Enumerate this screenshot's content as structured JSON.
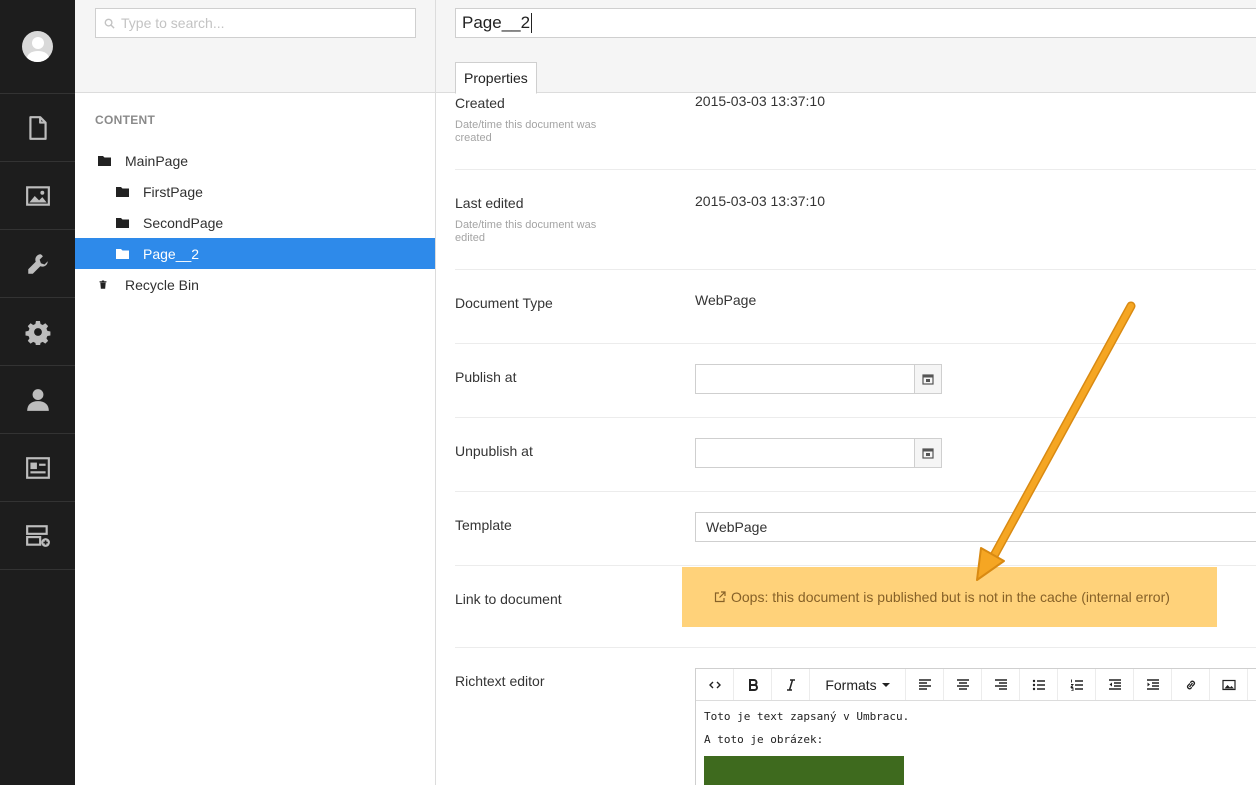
{
  "appbar": {
    "items": [
      {
        "name": "content-section",
        "icon": "document-icon"
      },
      {
        "name": "media-section",
        "icon": "image-icon"
      },
      {
        "name": "settings-section",
        "icon": "wrench-icon"
      },
      {
        "name": "developer-section",
        "icon": "gear-icon"
      },
      {
        "name": "users-section",
        "icon": "user-icon"
      },
      {
        "name": "members-section",
        "icon": "id-card-icon"
      },
      {
        "name": "forms-section",
        "icon": "add-layout-icon"
      }
    ]
  },
  "tree": {
    "search_placeholder": "Type to search...",
    "section_title": "CONTENT",
    "items": [
      {
        "label": "MainPage",
        "level": 0,
        "icon": "folder-icon"
      },
      {
        "label": "FirstPage",
        "level": 1,
        "icon": "folder-icon"
      },
      {
        "label": "SecondPage",
        "level": 1,
        "icon": "folder-icon"
      },
      {
        "label": "Page__2",
        "level": 1,
        "icon": "folder-icon",
        "selected": true
      },
      {
        "label": "Recycle Bin",
        "level": 0,
        "icon": "trash-icon"
      }
    ]
  },
  "editor": {
    "document_name": "Page__2",
    "tab_label": "Properties",
    "props": {
      "created": {
        "label": "Created",
        "desc": "Date/time this document was created",
        "value": "2015-03-03 13:37:10"
      },
      "last_edited": {
        "label": "Last edited",
        "desc": "Date/time this document was edited",
        "value": "2015-03-03 13:37:10"
      },
      "doc_type": {
        "label": "Document Type",
        "value": "WebPage"
      },
      "publish_at": {
        "label": "Publish at"
      },
      "unpublish_at": {
        "label": "Unpublish at"
      },
      "template": {
        "label": "Template",
        "value": "WebPage"
      },
      "link": {
        "label": "Link to document",
        "warning": "Oops: this document is published but is not in the cache (internal error)"
      },
      "richtext": {
        "label": "Richtext editor",
        "formats_label": "Formats",
        "paragraphs": [
          "Toto je text zapsaný v Umbracu.",
          "A toto je obrázek:"
        ]
      }
    }
  },
  "colors": {
    "appbar": "#1d1d1d",
    "selected": "#2e8aea",
    "warning_bg": "#ffd27a",
    "arrow": "#f5a623"
  }
}
